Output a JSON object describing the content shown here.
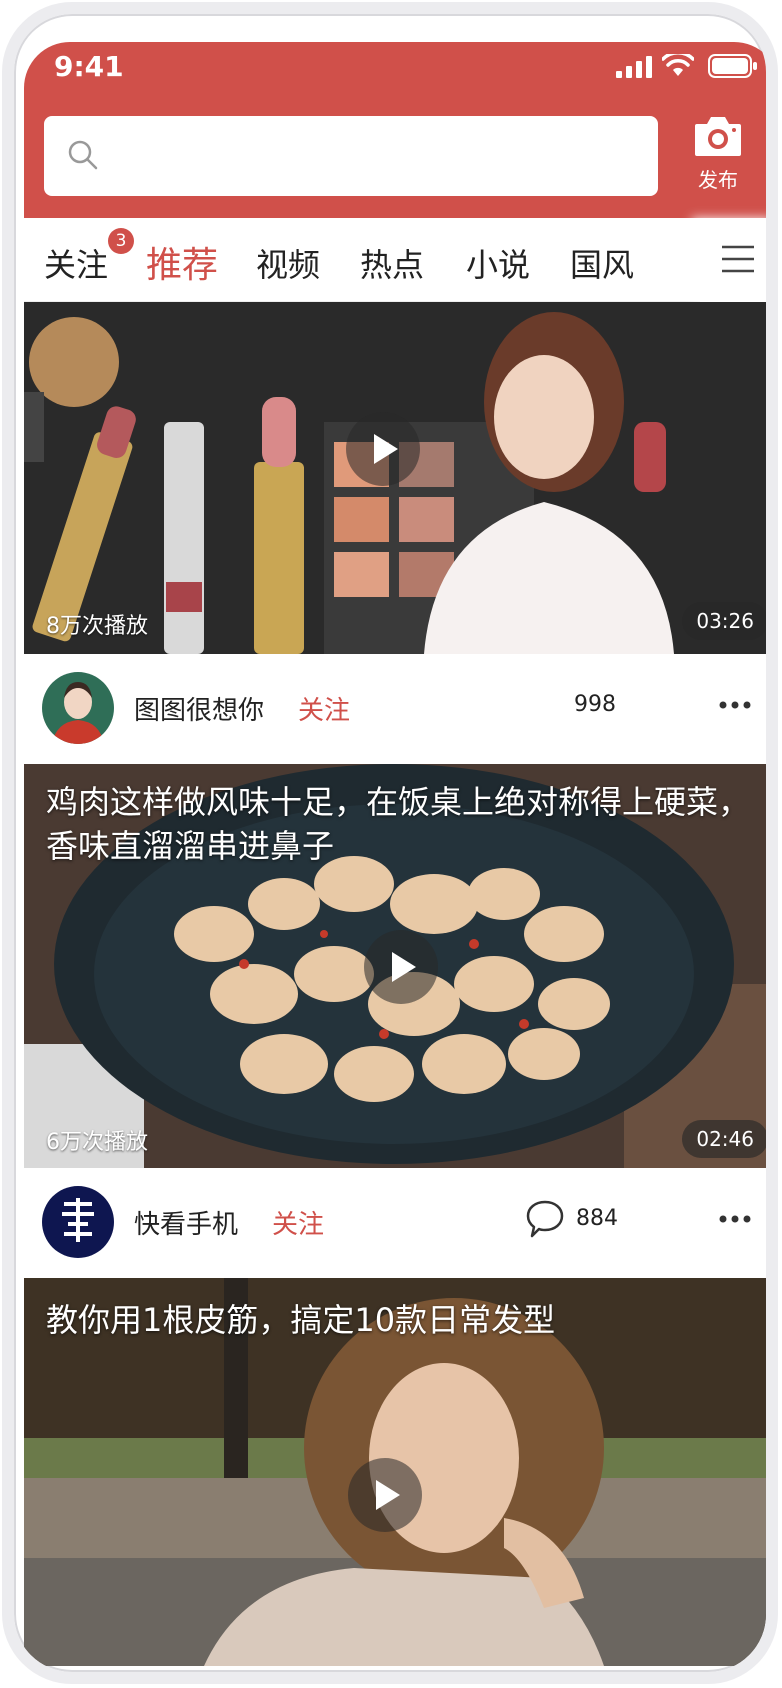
{
  "status": {
    "time": "9:41"
  },
  "search": {
    "placeholder": ""
  },
  "header": {
    "publish_label": "发布"
  },
  "tabs": [
    {
      "label": "关注",
      "badge": "3"
    },
    {
      "label": "推荐"
    },
    {
      "label": "视频"
    },
    {
      "label": "热点"
    },
    {
      "label": "小说"
    },
    {
      "label": "国风"
    }
  ],
  "feed": [
    {
      "views": "8万次播放",
      "duration": "03:26",
      "author": "图图很想你",
      "follow": "关注",
      "count": "998"
    },
    {
      "title": "鸡肉这样做风味十足，在饭桌上绝对称得上硬菜， 香味直溜溜串进鼻子",
      "views": "6万次播放",
      "duration": "02:46",
      "author": "快看手机",
      "follow": "关注",
      "count": "884"
    },
    {
      "title": "教你用1根皮筋，搞定10款日常发型"
    }
  ],
  "colors": {
    "accent": "#d0504a",
    "badge": "#d0504a"
  },
  "icons": [
    "search-icon",
    "camera-icon",
    "menu-icon",
    "play-icon",
    "comment-icon",
    "more-icon",
    "signal-icon",
    "wifi-icon",
    "battery-icon"
  ]
}
